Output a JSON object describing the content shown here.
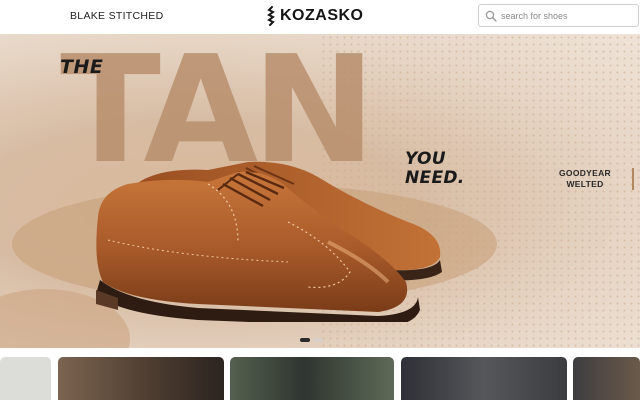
{
  "header": {
    "nav_link": "BLAKE STITCHED",
    "logo_text": "KOZASKO",
    "search_placeholder": "search for shoes"
  },
  "hero": {
    "headline_small": "THE",
    "headline_big": "TAN",
    "headline_line1": "YOU",
    "headline_line2": "NEED.",
    "feature_line1": "GOODYEAR",
    "feature_line2": "WELTED",
    "carousel_total": 2,
    "carousel_active": 1
  },
  "thumbnails": [
    {
      "name": "thumb-1",
      "color": "#dcdcd8"
    },
    {
      "name": "thumb-2",
      "color": "#6b5846"
    },
    {
      "name": "thumb-3",
      "color": "#3f4a3c"
    },
    {
      "name": "thumb-4",
      "color": "#3a3c40"
    },
    {
      "name": "thumb-5",
      "color": "#4b4a4c"
    }
  ],
  "colors": {
    "accent": "#b88f6d",
    "dark": "#1a1a1a",
    "shoe": "#a85a2a"
  }
}
